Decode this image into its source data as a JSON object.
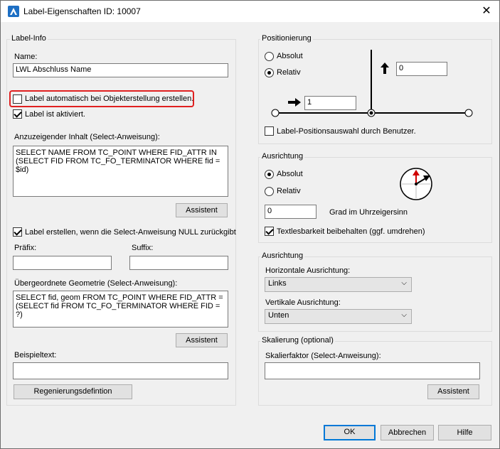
{
  "window": {
    "title": "Label-Eigenschaften ID: 10007"
  },
  "label_info": {
    "group_title": "Label-Info",
    "name_label": "Name:",
    "name_value": "LWL Abschluss Name",
    "auto_create_label": "Label automatisch bei Objekterstellung erstellen.",
    "activated_label": "Label ist aktiviert.",
    "content_label": "Anzuzeigender Inhalt (Select-Anweisung):",
    "content_value": "SELECT NAME FROM TC_POINT WHERE FID_ATTR IN (SELECT FID FROM TC_FO_TERMINATOR WHERE fid = $id)",
    "assistant1": "Assistent",
    "create_if_null_label": "Label erstellen, wenn die Select-Anweisung NULL zurückgibt",
    "prefix_label": "Präfix:",
    "prefix_value": "",
    "suffix_label": "Suffix:",
    "suffix_value": "",
    "parent_geom_label": "Übergeordnete Geometrie (Select-Anweisung):",
    "parent_geom_value": "SELECT fid, geom FROM TC_POINT WHERE FID_ATTR = (SELECT fid FROM TC_FO_TERMINATOR WHERE FID = ?)",
    "assistant2": "Assistent",
    "sample_text_label": "Beispieltext:",
    "sample_text_value": "",
    "regen_button": "Regenierungsdefintion"
  },
  "positioning": {
    "group_title": "Positionierung",
    "absolute": "Absolut",
    "relative": "Relativ",
    "y_value": "0",
    "x_value": "1",
    "user_selection": "Label-Positionsauswahl durch Benutzer."
  },
  "orientation": {
    "group_title": "Ausrichtung",
    "absolute": "Absolut",
    "relative": "Relativ",
    "degrees_value": "0",
    "degrees_label": "Grad im Uhrzeigersinn",
    "readability_label": "Textlesbarkeit beibehalten (ggf. umdrehen)"
  },
  "alignment": {
    "group_title": "Ausrichtung",
    "horizontal_label": "Horizontale Ausrichtung:",
    "horizontal_value": "Links",
    "vertical_label": "Vertikale Ausrichtung:",
    "vertical_value": "Unten"
  },
  "scaling": {
    "group_title": "Skalierung (optional)",
    "factor_label": "Skalierfaktor (Select-Anweisung):",
    "factor_value": "",
    "assistant": "Assistent"
  },
  "footer": {
    "ok": "OK",
    "cancel": "Abbrechen",
    "help": "Hilfe"
  },
  "colors": {
    "highlight": "#e02020",
    "focus": "#0078d7",
    "compass_arrow": "#d00000"
  },
  "icons": {
    "app": "app-logo-icon",
    "close": "close-icon",
    "up_arrow": "arrow-up-icon",
    "right_arrow": "arrow-right-icon",
    "compass": "compass-icon"
  }
}
